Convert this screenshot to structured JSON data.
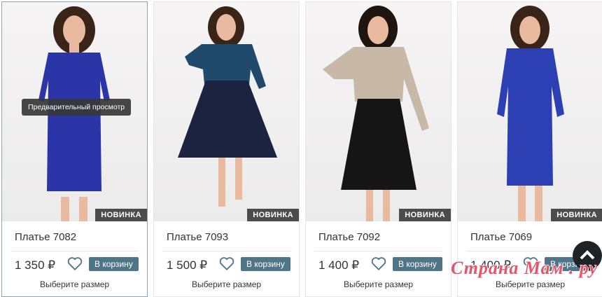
{
  "badge_label": "НОВИНКА",
  "preview_label": "Предварительный просмотр",
  "add_to_cart_label": "В корзину",
  "select_size_label": "Выберите размер",
  "currency_symbol": "₽",
  "products": [
    {
      "name": "Платье 7082",
      "price": "1 350 ₽",
      "dress_color": "#2b35a8"
    },
    {
      "name": "Платье 7093",
      "price": "1 500 ₽",
      "dress_color": "#1b2340"
    },
    {
      "name": "Платье 7092",
      "price": "1 400 ₽",
      "dress_color": "#151515"
    },
    {
      "name": "Платье 7069",
      "price": "1 400 ₽",
      "dress_color": "#2c3fb3"
    }
  ],
  "watermark": "Страна Мам . ру",
  "colors": {
    "button": "#4f7588",
    "badge": "#4c4c4c",
    "watermark": "#e5566a"
  }
}
